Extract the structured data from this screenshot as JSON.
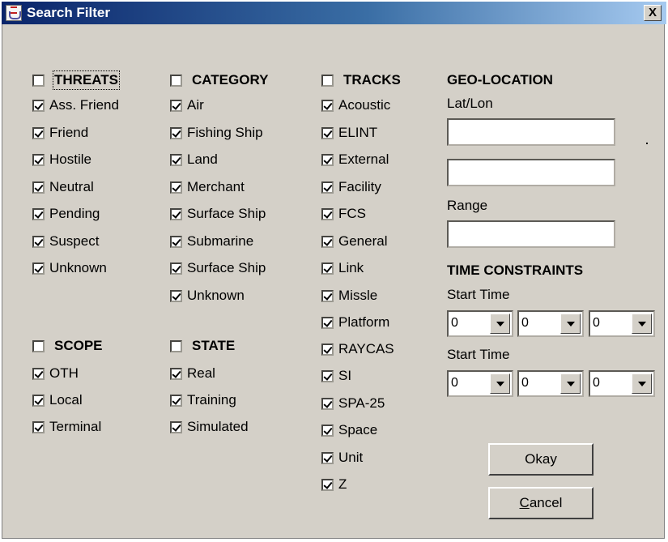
{
  "window": {
    "title": "Search Filter",
    "close": "X",
    "app_icon": "java-cup-icon"
  },
  "threats": {
    "header": "THREATS",
    "header_checked": false,
    "items": [
      {
        "label": "Ass. Friend",
        "checked": true
      },
      {
        "label": "Friend",
        "checked": true
      },
      {
        "label": "Hostile",
        "checked": true
      },
      {
        "label": "Neutral",
        "checked": true
      },
      {
        "label": "Pending",
        "checked": true
      },
      {
        "label": "Suspect",
        "checked": true
      },
      {
        "label": "Unknown",
        "checked": true
      }
    ]
  },
  "category": {
    "header": "CATEGORY",
    "header_checked": false,
    "items": [
      {
        "label": "Air",
        "checked": true
      },
      {
        "label": "Fishing Ship",
        "checked": true
      },
      {
        "label": "Land",
        "checked": true
      },
      {
        "label": "Merchant",
        "checked": true
      },
      {
        "label": "Surface Ship",
        "checked": true
      },
      {
        "label": "Submarine",
        "checked": true
      },
      {
        "label": "Surface Ship",
        "checked": true
      },
      {
        "label": "Unknown",
        "checked": true
      }
    ]
  },
  "tracks": {
    "header": "TRACKS",
    "header_checked": false,
    "items": [
      {
        "label": "Acoustic",
        "checked": true
      },
      {
        "label": "ELINT",
        "checked": true
      },
      {
        "label": "External",
        "checked": true
      },
      {
        "label": "Facility",
        "checked": true
      },
      {
        "label": "FCS",
        "checked": true
      },
      {
        "label": "General",
        "checked": true
      },
      {
        "label": "Link",
        "checked": true
      },
      {
        "label": "Missle",
        "checked": true
      },
      {
        "label": "Platform",
        "checked": true
      },
      {
        "label": "RAYCAS",
        "checked": true
      },
      {
        "label": "SI",
        "checked": true
      },
      {
        "label": "SPA-25",
        "checked": true
      },
      {
        "label": "Space",
        "checked": true
      },
      {
        "label": "Unit",
        "checked": true
      },
      {
        "label": "Z",
        "checked": true
      }
    ]
  },
  "scope": {
    "header": "SCOPE",
    "header_checked": false,
    "items": [
      {
        "label": "OTH",
        "checked": true
      },
      {
        "label": "Local",
        "checked": true
      },
      {
        "label": "Terminal",
        "checked": true
      }
    ]
  },
  "state": {
    "header": "STATE",
    "header_checked": false,
    "items": [
      {
        "label": "Real",
        "checked": true
      },
      {
        "label": "Training",
        "checked": true
      },
      {
        "label": "Simulated",
        "checked": true
      }
    ]
  },
  "geo": {
    "header": "GEO-LOCATION",
    "latlon_label": "Lat/Lon",
    "lat_value": "",
    "lon_value": "",
    "range_label": "Range",
    "range_value": ""
  },
  "time": {
    "header": "TIME CONSTRAINTS",
    "start_label_1": "Start Time",
    "start_label_2": "Start Time",
    "row1": [
      "0",
      "0",
      "0"
    ],
    "row2": [
      "0",
      "0",
      "0"
    ]
  },
  "buttons": {
    "okay": "Okay",
    "cancel_mnemonic": "C",
    "cancel_rest": "ancel"
  }
}
